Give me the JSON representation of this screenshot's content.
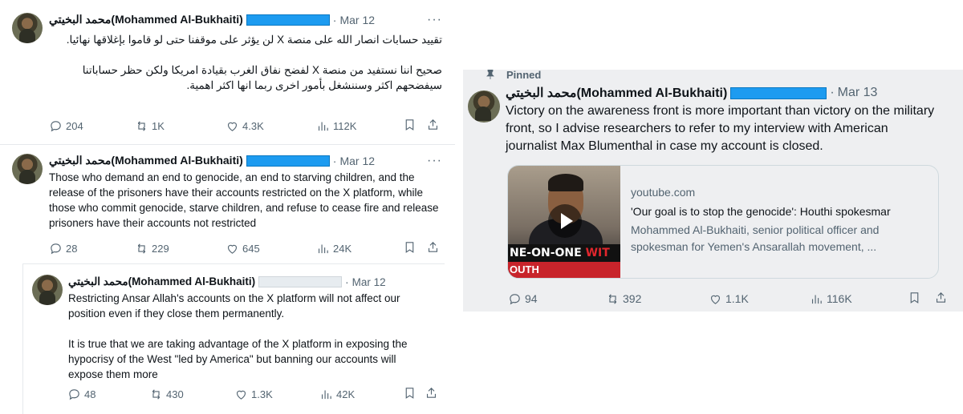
{
  "tweets_left": [
    {
      "name": "محمد البخيتي(Mohammed Al-Bukhaiti)",
      "date": "Mar 12",
      "more": "···",
      "text": "تقييد حسابات انصار الله على منصة X لن يؤثر على موقفنا حتى لو قاموا بإغلاقها نهائيا.\n\nصحيح اننا نستفيد من منصة X لفضح نفاق الغرب بقيادة امريكا ولكن حظر حساباتنا سيفضحهم اكثر وسننشغل بأمور اخرى ربما انها اكثر اهمية.",
      "replies": "204",
      "reposts": "1K",
      "likes": "4.3K",
      "views": "112K"
    },
    {
      "name": "محمد البخيتي(Mohammed Al-Bukhaiti)",
      "date": "Mar 12",
      "more": "···",
      "text": "Those who demand an end to genocide, an end to starving children, and the release of the prisoners have their accounts restricted on the X platform, while those who commit genocide, starve children, and refuse to cease fire and release prisoners have their accounts not restricted",
      "replies": "28",
      "reposts": "229",
      "likes": "645",
      "views": "24K"
    },
    {
      "name": "محمد البخيتي(Mohammed Al-Bukhaiti)",
      "date": "Mar 12",
      "text": "Restricting Ansar Allah's accounts on the X platform will not affect our position even if they close them permanently.\n\nIt is true that we are taking advantage of the X platform in exposing the hypocrisy of the West \"led by America\" but banning our accounts will expose them more",
      "replies": "48",
      "reposts": "430",
      "likes": "1.3K",
      "views": "42K"
    }
  ],
  "tweet_right": {
    "pinned_label": "Pinned",
    "name": "محمد البخيتي(Mohammed Al-Bukhaiti)",
    "date": "Mar 13",
    "text": "Victory on the awareness front is more important than victory on the military front, so I advise researchers to refer to my interview with American journalist Max Blumenthal in case my account is closed.",
    "card": {
      "domain": "youtube.com",
      "title": "'Our goal is to stop the genocide': Houthi spokesmar",
      "description": "Mohammed Al-Bukhaiti, senior political officer and spokesman for Yemen's Ansarallah movement, ...",
      "thumb_banner_white": "NE-ON-ONE ",
      "thumb_banner_red": "WIT",
      "thumb_banner2": "OUTH"
    },
    "replies": "94",
    "reposts": "392",
    "likes": "1.1K",
    "views": "116K"
  },
  "colors": {
    "redaction": "#1d9bf0",
    "muted_text": "#536471",
    "right_panel_bg": "#eeeff1"
  },
  "icons": [
    "reply-icon",
    "repost-icon",
    "like-icon",
    "views-icon",
    "bookmark-icon",
    "share-icon",
    "pin-icon",
    "more-icon",
    "play-icon"
  ]
}
